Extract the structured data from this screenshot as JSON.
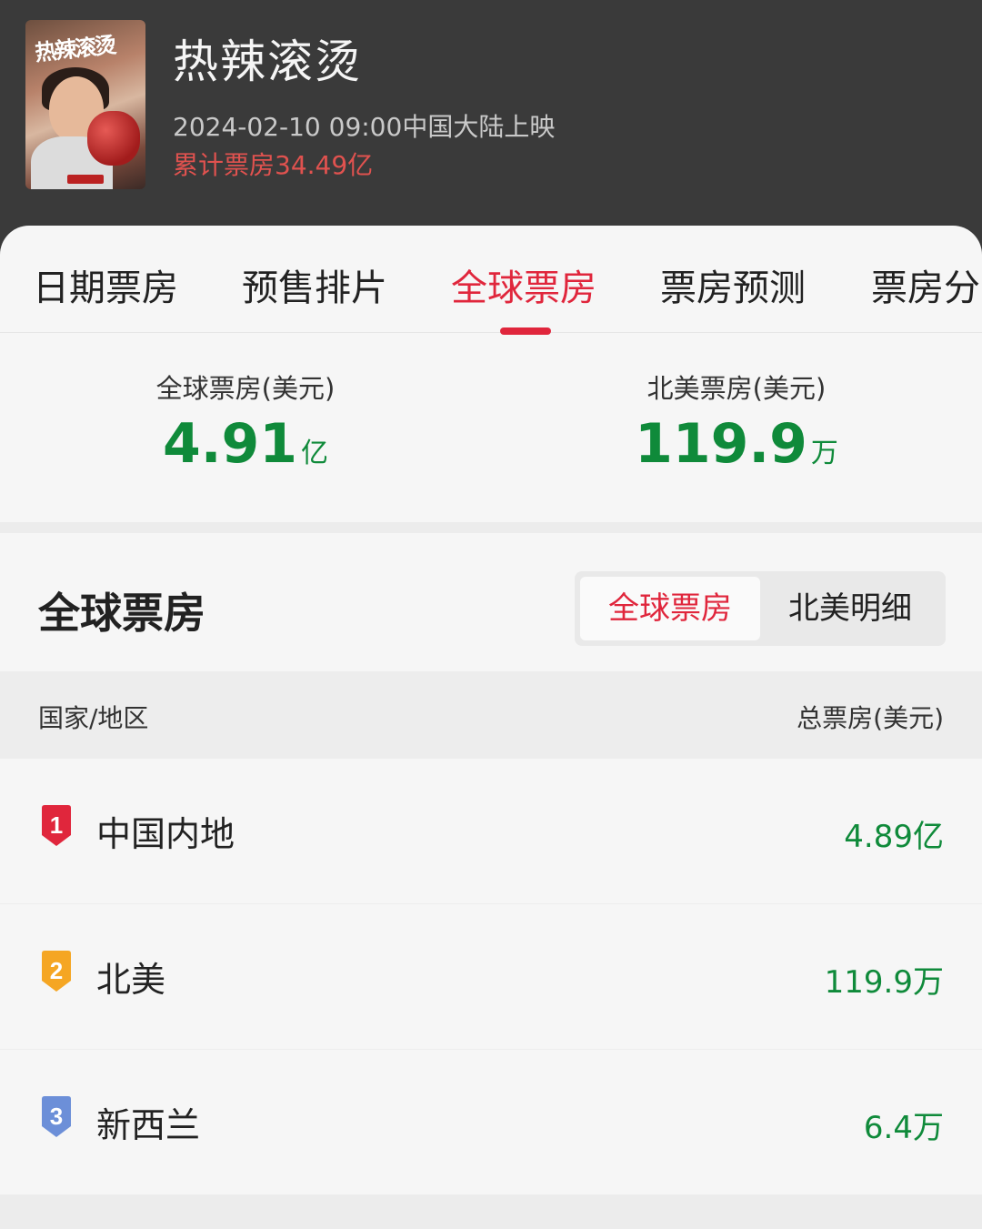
{
  "movie": {
    "title": "热辣滚烫",
    "release": "2024-02-10 09:00中国大陆上映",
    "cumulative_box_office": "累计票房34.49亿",
    "poster_title": "热辣滚烫"
  },
  "tabs": [
    {
      "label": "日期票房",
      "active": false
    },
    {
      "label": "预售排片",
      "active": false
    },
    {
      "label": "全球票房",
      "active": true
    },
    {
      "label": "票房预测",
      "active": false
    },
    {
      "label": "票房分",
      "active": false
    }
  ],
  "stats": {
    "global": {
      "label": "全球票房(美元)",
      "value": "4.91",
      "unit": "亿"
    },
    "north_america": {
      "label": "北美票房(美元)",
      "value": "119.9",
      "unit": "万"
    }
  },
  "section": {
    "title": "全球票房",
    "toggle_active": "全球票房",
    "toggle_other": "北美明细"
  },
  "table": {
    "col_region": "国家/地区",
    "col_total": "总票房(美元)",
    "rows": [
      {
        "rank": "1",
        "region": "中国内地",
        "total": "4.89亿",
        "badge_color": "#e0263c"
      },
      {
        "rank": "2",
        "region": "北美",
        "total": "119.9万",
        "badge_color": "#f5a623"
      },
      {
        "rank": "3",
        "region": "新西兰",
        "total": "6.4万",
        "badge_color": "#6c8fd8"
      }
    ]
  },
  "colors": {
    "accent": "#e0263c",
    "value_green": "#0f8a3a",
    "header_bg": "#3a3a3a"
  }
}
